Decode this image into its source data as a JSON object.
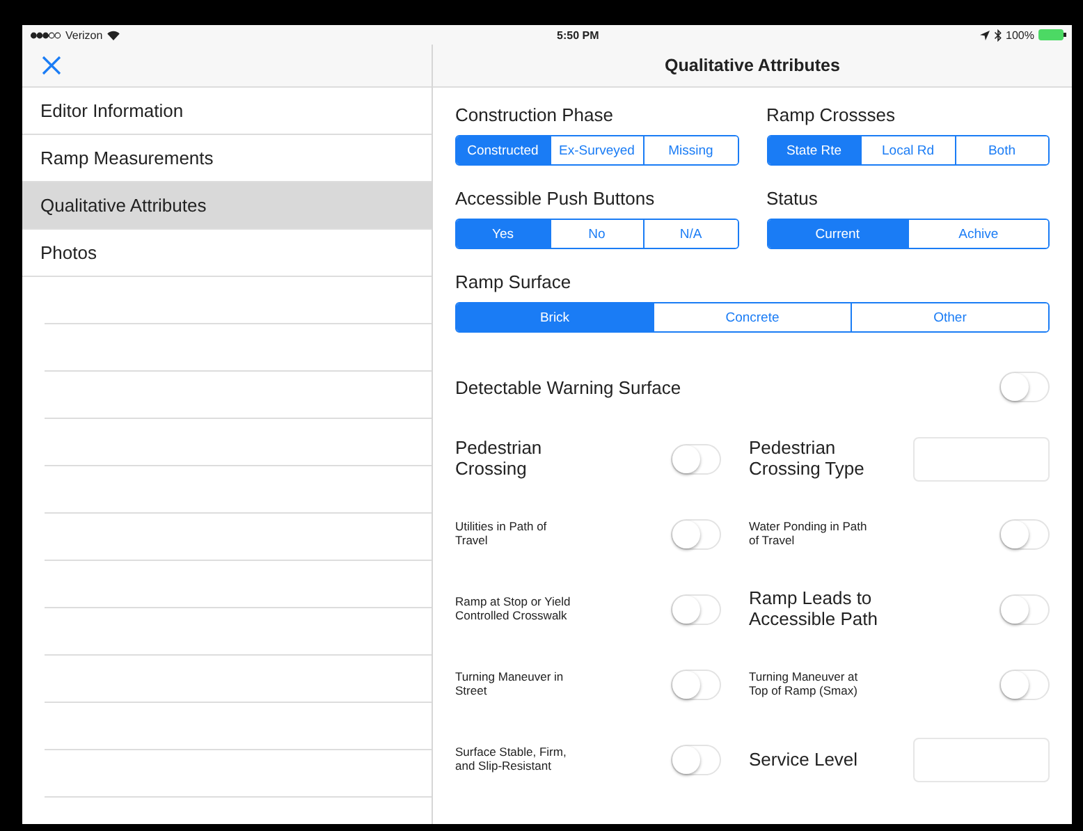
{
  "status_bar": {
    "carrier": "Verizon",
    "time": "5:50 PM",
    "battery": "100%"
  },
  "nav_bar": {
    "title": "Qualitative Attributes"
  },
  "sidebar": {
    "items": [
      {
        "label": "Editor Information",
        "selected": false
      },
      {
        "label": "Ramp Measurements",
        "selected": false
      },
      {
        "label": "Qualitative Attributes",
        "selected": true
      },
      {
        "label": "Photos",
        "selected": false
      }
    ]
  },
  "segment_groups": [
    {
      "label": "Construction Phase",
      "options": [
        {
          "label": "Constructed",
          "selected": true
        },
        {
          "label": "Ex-Surveyed",
          "selected": false
        },
        {
          "label": "Missing",
          "selected": false
        }
      ]
    },
    {
      "label": "Ramp Crossses",
      "options": [
        {
          "label": "State Rte",
          "selected": true
        },
        {
          "label": "Local Rd",
          "selected": false
        },
        {
          "label": "Both",
          "selected": false
        }
      ]
    },
    {
      "label": "Accessible Push Buttons",
      "options": [
        {
          "label": "Yes",
          "selected": true
        },
        {
          "label": "No",
          "selected": false
        },
        {
          "label": "N/A",
          "selected": false
        }
      ]
    },
    {
      "label": "Status",
      "options": [
        {
          "label": "Current",
          "selected": true
        },
        {
          "label": "Achive",
          "selected": false
        }
      ]
    }
  ],
  "ramp_surface": {
    "label": "Ramp Surface",
    "options": [
      {
        "label": "Brick",
        "selected": true
      },
      {
        "label": "Concrete",
        "selected": false
      },
      {
        "label": "Other",
        "selected": false
      }
    ]
  },
  "detectable_warning_surface": {
    "label": "Detectable Warning Surface",
    "on": false
  },
  "attributes": [
    {
      "kind": "toggle",
      "label": "Pedestrian Crossing",
      "on": false
    },
    {
      "kind": "field",
      "label": "Pedestrian Crossing Type"
    },
    {
      "kind": "smalltoggle",
      "label": "Utilities in Path of Travel",
      "on": false
    },
    {
      "kind": "smalltoggle",
      "label": "Water Ponding in Path of Travel",
      "on": false
    },
    {
      "kind": "smalltoggle",
      "label": "Ramp at Stop or Yield Controlled Crosswalk",
      "on": false
    },
    {
      "kind": "toggle",
      "label": "Ramp Leads to Accessible Path",
      "on": false
    },
    {
      "kind": "smalltoggle",
      "label": "Turning Maneuver in Street",
      "on": false
    },
    {
      "kind": "smalltoggle",
      "label": "Turning Maneuver at Top of Ramp (Smax)",
      "on": false
    },
    {
      "kind": "smalltoggle",
      "label": "Surface Stable, Firm, and Slip-Resistant",
      "on": false
    },
    {
      "kind": "field",
      "label": "Service Level"
    }
  ]
}
